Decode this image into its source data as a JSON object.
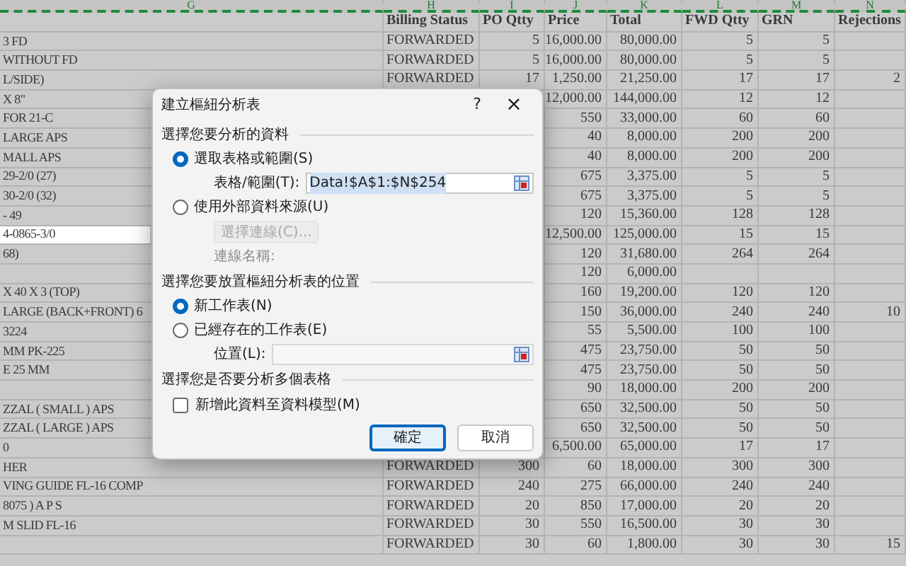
{
  "columns": [
    "G",
    "H",
    "I",
    "J",
    "K",
    "L",
    "M",
    "N"
  ],
  "header": [
    "Billing Status",
    "PO Qtty",
    "Price",
    "Total",
    "FWD Qtty",
    "GRN",
    "Rejections"
  ],
  "rows": [
    {
      "cells": [
        "3 FD",
        "FORWARDED",
        "5",
        "16,000.00",
        "80,000.00",
        "5",
        "5",
        null
      ],
      "selected": false
    },
    {
      "cells": [
        "WITHOUT FD",
        "FORWARDED",
        "5",
        "16,000.00",
        "80,000.00",
        "5",
        "5",
        null
      ],
      "selected": false
    },
    {
      "cells": [
        "L/SIDE)",
        "FORWARDED",
        "17",
        "1,250.00",
        "21,250.00",
        "17",
        "17",
        "2"
      ],
      "selected": false
    },
    {
      "cells": [
        "X 8\"",
        null,
        null,
        "12,000.00",
        "144,000.00",
        "12",
        "12",
        null
      ],
      "selected": false
    },
    {
      "cells": [
        "FOR 21-C",
        null,
        null,
        "550",
        "33,000.00",
        "60",
        "60",
        null
      ],
      "selected": false
    },
    {
      "cells": [
        "LARGE APS",
        null,
        null,
        "40",
        "8,000.00",
        "200",
        "200",
        null
      ],
      "selected": false
    },
    {
      "cells": [
        "MALL APS",
        null,
        null,
        "40",
        "8,000.00",
        "200",
        "200",
        null
      ],
      "selected": false
    },
    {
      "cells": [
        "29-2/0 (27)",
        null,
        null,
        "675",
        "3,375.00",
        "5",
        "5",
        null
      ],
      "selected": false
    },
    {
      "cells": [
        "30-2/0 (32)",
        null,
        null,
        "675",
        "3,375.00",
        "5",
        "5",
        null
      ],
      "selected": false
    },
    {
      "cells": [
        "- 49",
        null,
        null,
        "120",
        "15,360.00",
        "128",
        "128",
        null
      ],
      "selected": false
    },
    {
      "cells": [
        "4-0865-3/0",
        null,
        null,
        "12,500.00",
        "125,000.00",
        "15",
        "15",
        null
      ],
      "selected": true
    },
    {
      "cells": [
        "68)",
        null,
        null,
        "120",
        "31,680.00",
        "264",
        "264",
        null
      ],
      "selected": false
    },
    {
      "cells": [
        null,
        null,
        null,
        "120",
        "6,000.00",
        null,
        null,
        null
      ],
      "selected": false
    },
    {
      "cells": [
        "X 40 X 3 (TOP)",
        null,
        null,
        "160",
        "19,200.00",
        "120",
        "120",
        null
      ],
      "selected": false
    },
    {
      "cells": [
        "LARGE (BACK+FRONT) 6",
        null,
        null,
        "150",
        "36,000.00",
        "240",
        "240",
        "10"
      ],
      "selected": false
    },
    {
      "cells": [
        "3224",
        null,
        null,
        "55",
        "5,500.00",
        "100",
        "100",
        null
      ],
      "selected": false
    },
    {
      "cells": [
        "MM PK-225",
        null,
        null,
        "475",
        "23,750.00",
        "50",
        "50",
        null
      ],
      "selected": false
    },
    {
      "cells": [
        "E 25  MM",
        null,
        null,
        "475",
        "23,750.00",
        "50",
        "50",
        null
      ],
      "selected": false
    },
    {
      "cells": [
        null,
        null,
        null,
        "90",
        "18,000.00",
        "200",
        "200",
        null
      ],
      "selected": false
    },
    {
      "cells": [
        "ZZAL ( SMALL ) APS",
        null,
        null,
        "650",
        "32,500.00",
        "50",
        "50",
        null
      ],
      "selected": false
    },
    {
      "cells": [
        "ZZAL ( LARGE ) APS",
        null,
        null,
        "650",
        "32,500.00",
        "50",
        "50",
        null
      ],
      "selected": false
    },
    {
      "cells": [
        "0",
        null,
        null,
        "6,500.00",
        "65,000.00",
        "17",
        "17",
        null
      ],
      "selected": false
    },
    {
      "cells": [
        "HER",
        "FORWARDED",
        "300",
        "60",
        "18,000.00",
        "300",
        "300",
        null
      ],
      "selected": false
    },
    {
      "cells": [
        "VING  GUIDE FL-16 COMP",
        "FORWARDED",
        "240",
        "275",
        "66,000.00",
        "240",
        "240",
        null
      ],
      "selected": false
    },
    {
      "cells": [
        "8075 ) A P S",
        "FORWARDED",
        "20",
        "850",
        "17,000.00",
        "20",
        "20",
        null
      ],
      "selected": false
    },
    {
      "cells": [
        "M SLID FL-16",
        "FORWARDED",
        "30",
        "550",
        "16,500.00",
        "30",
        "30",
        null
      ],
      "selected": false
    },
    {
      "cells": [
        null,
        "FORWARDED",
        "30",
        "60",
        "1,800.00",
        "30",
        "30",
        "15"
      ],
      "selected": false
    }
  ],
  "dialog": {
    "title": "建立樞紐分析表",
    "help": "?",
    "close": "×",
    "source_section": "選擇您要分析的資料",
    "source_options": [
      {
        "label": "選取表格或範圍(S)",
        "selected": true
      },
      {
        "label": "使用外部資料來源(U)",
        "selected": false
      }
    ],
    "range_label": "表格/範圍(T):",
    "range_value": "Data!$A$1:$N$254",
    "connection_button": {
      "label": "選擇連線(C)...",
      "disabled": true
    },
    "connection_name_label": "連線名稱:",
    "location_section": "選擇您要放置樞紐分析表的位置",
    "location_options": [
      {
        "label": "新工作表(N)",
        "selected": true
      },
      {
        "label": "已經存在的工作表(E)",
        "selected": false
      }
    ],
    "location_label": "位置(L):",
    "multi_section": "選擇您是否要分析多個表格",
    "data_model": {
      "label": "新增此資料至資料模型(M)",
      "checked": false
    },
    "buttons": [
      {
        "label": "確定",
        "focused": true
      },
      {
        "label": "取消",
        "focused": false
      }
    ]
  }
}
